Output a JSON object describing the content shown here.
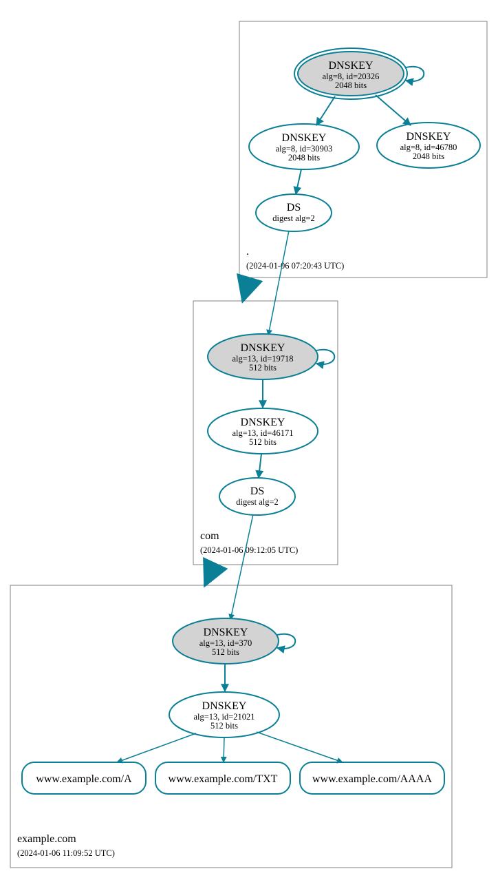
{
  "chart_data": {
    "type": "diagram",
    "zones": [
      {
        "name": ".",
        "timestamp": "(2024-01-06 07:20:43 UTC)"
      },
      {
        "name": "com",
        "timestamp": "(2024-01-06 09:12:05 UTC)"
      },
      {
        "name": "example.com",
        "timestamp": "(2024-01-06 11:09:52 UTC)"
      }
    ],
    "nodes": {
      "root_ksk": {
        "title": "DNSKEY",
        "line2": "alg=8, id=20326",
        "line3": "2048 bits"
      },
      "root_zsk": {
        "title": "DNSKEY",
        "line2": "alg=8, id=30903",
        "line3": "2048 bits"
      },
      "root_other": {
        "title": "DNSKEY",
        "line2": "alg=8, id=46780",
        "line3": "2048 bits"
      },
      "root_ds": {
        "title": "DS",
        "line2": "digest alg=2"
      },
      "com_ksk": {
        "title": "DNSKEY",
        "line2": "alg=13, id=19718",
        "line3": "512 bits"
      },
      "com_zsk": {
        "title": "DNSKEY",
        "line2": "alg=13, id=46171",
        "line3": "512 bits"
      },
      "com_ds": {
        "title": "DS",
        "line2": "digest alg=2"
      },
      "ex_ksk": {
        "title": "DNSKEY",
        "line2": "alg=13, id=370",
        "line3": "512 bits"
      },
      "ex_zsk": {
        "title": "DNSKEY",
        "line2": "alg=13, id=21021",
        "line3": "512 bits"
      },
      "rr_a": {
        "label": "www.example.com/A"
      },
      "rr_txt": {
        "label": "www.example.com/TXT"
      },
      "rr_aaaa": {
        "label": "www.example.com/AAAA"
      }
    },
    "edges": [
      {
        "from": "root_ksk",
        "to": "root_ksk"
      },
      {
        "from": "root_ksk",
        "to": "root_zsk"
      },
      {
        "from": "root_ksk",
        "to": "root_other"
      },
      {
        "from": "root_zsk",
        "to": "root_ds"
      },
      {
        "from": "root_ds",
        "to": "com_ksk"
      },
      {
        "from": "com_ksk",
        "to": "com_ksk"
      },
      {
        "from": "com_ksk",
        "to": "com_zsk"
      },
      {
        "from": "com_zsk",
        "to": "com_ds"
      },
      {
        "from": "com_ds",
        "to": "ex_ksk"
      },
      {
        "from": "ex_ksk",
        "to": "ex_ksk"
      },
      {
        "from": "ex_ksk",
        "to": "ex_zsk"
      },
      {
        "from": "ex_zsk",
        "to": "rr_a"
      },
      {
        "from": "ex_zsk",
        "to": "rr_txt"
      },
      {
        "from": "ex_zsk",
        "to": "rr_aaaa"
      }
    ],
    "zone_delegations": [
      {
        "from_zone": ".",
        "to_zone": "com"
      },
      {
        "from_zone": "com",
        "to_zone": "example.com"
      }
    ]
  },
  "colors": {
    "edge": "#0a7f96",
    "trust_fill": "#d3d3d3",
    "zone_border": "#808080"
  }
}
